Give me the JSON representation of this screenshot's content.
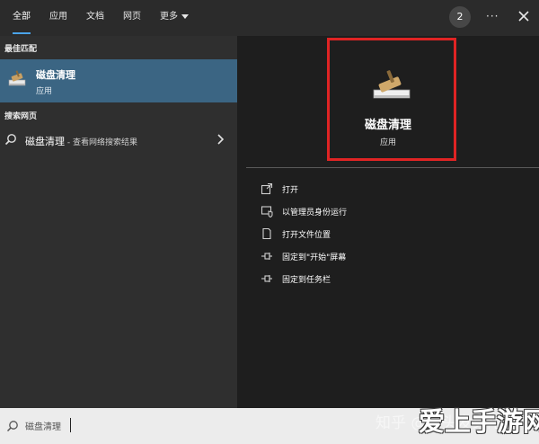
{
  "header": {
    "tabs": [
      {
        "label": "全部",
        "active": true
      },
      {
        "label": "应用",
        "active": false
      },
      {
        "label": "文档",
        "active": false
      },
      {
        "label": "网页",
        "active": false
      },
      {
        "label": "更多",
        "active": false
      }
    ],
    "badge_count": "2",
    "more_glyph": "···",
    "accent": "#4aa3e8"
  },
  "left": {
    "best_match_label": "最佳匹配",
    "best_match": {
      "title": "磁盘清理",
      "subtitle": "应用",
      "icon": "disk-cleanup-icon",
      "bg": "#3b6583"
    },
    "web_label": "搜索网页",
    "web_result": {
      "title": "磁盘清理",
      "subtitle": " - 查看网络搜索结果",
      "icon": "search-icon"
    }
  },
  "preview": {
    "title": "磁盘清理",
    "subtitle": "应用",
    "icon": "disk-cleanup-icon",
    "highlight_color": "#e02424",
    "actions": [
      {
        "label": "打开",
        "icon": "open-icon"
      },
      {
        "label": "以管理员身份运行",
        "icon": "run-as-admin-icon"
      },
      {
        "label": "打开文件位置",
        "icon": "file-location-icon"
      },
      {
        "label": "固定到\"开始\"屏幕",
        "icon": "pin-icon"
      },
      {
        "label": "固定到任务栏",
        "icon": "pin-icon"
      }
    ]
  },
  "search": {
    "value": "磁盘清理",
    "icon": "search-icon"
  },
  "watermark": {
    "zhihu": "知乎 @包头发芽陀子",
    "site": "爱上手游网"
  }
}
